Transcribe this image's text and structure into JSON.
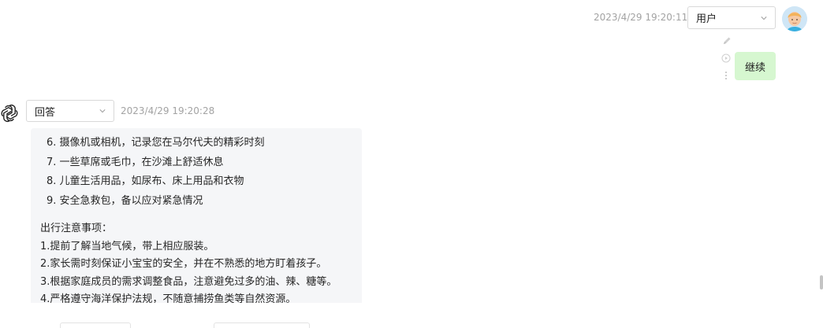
{
  "user_message": {
    "timestamp": "2023/4/29 19:20:11",
    "role_select": "用户",
    "text": "继续",
    "icons": [
      "pencil-icon",
      "play-circle-icon",
      "more-vertical-icon"
    ]
  },
  "assistant_message": {
    "role_select": "回答",
    "timestamp": "2023/4/29 19:20:28",
    "list_items": [
      "6. 摄像机或相机，记录您在马尔代夫的精彩时刻",
      "7. 一些草席或毛巾，在沙滩上舒适休息",
      "8. 儿童生活用品，如尿布、床上用品和衣物",
      "9. 安全急救包，备以应对紧急情况"
    ],
    "notes_title": "出行注意事项：",
    "notes": [
      "1.提前了解当地气候，带上相应服装。",
      "2.家长需时刻保证小宝宝的安全，并在不熟悉的地方盯着孩子。",
      "3.根据家庭成员的需求调整食品，注意避免过多的油、辣、糖等。",
      "4.严格遵守海洋保护法规，不随意捕捞鱼类等自然资源。"
    ]
  },
  "colors": {
    "user_bubble": "#d6f7d0",
    "assistant_panel": "#f5f6f8",
    "timestamp": "#a3a3a3"
  }
}
